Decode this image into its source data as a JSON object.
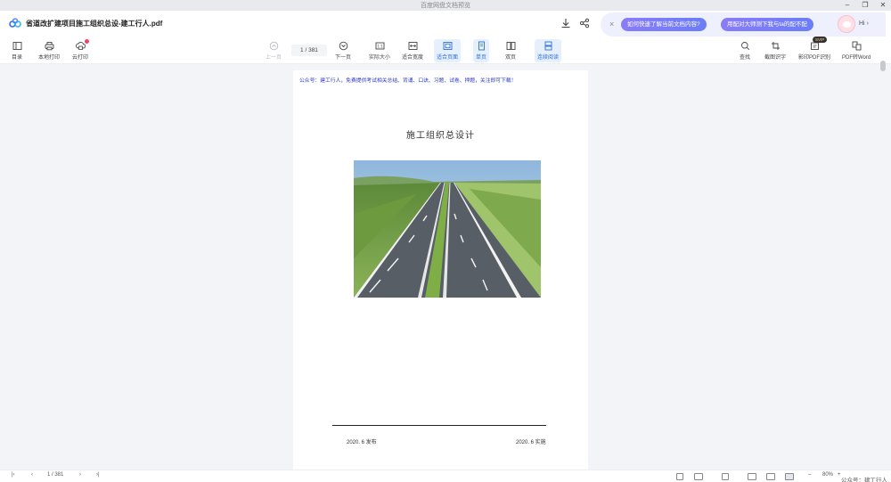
{
  "window": {
    "title": "百度网盘文档预览",
    "controls": [
      "minimize-icon",
      "restore-icon",
      "close-icon"
    ]
  },
  "header": {
    "doc_title": "省道改扩建项目施工组织总设-建工行人.pdf",
    "actions": [
      "download-icon",
      "share-icon"
    ]
  },
  "assistant": {
    "chips": [
      "如何快速了解当前文档内容?",
      "用配对大师测下我与ta的配不配"
    ],
    "greeting": "Hi",
    "chevron": "›",
    "close": "×"
  },
  "toolbar": {
    "left": [
      {
        "label": "目录",
        "icon": "catalog-icon"
      },
      {
        "label": "本地打印",
        "icon": "printer-icon"
      },
      {
        "label": "云打印",
        "icon": "cloud-print-icon"
      }
    ],
    "prev_label": "上一页",
    "page_indicator": "1 / 381",
    "next_label": "下一页",
    "view_modes": [
      {
        "label": "实际大小",
        "icon": "actual-size-icon",
        "active": false
      },
      {
        "label": "适合宽度",
        "icon": "fit-width-icon",
        "active": false
      },
      {
        "label": "适合页面",
        "icon": "fit-page-icon",
        "active": true
      },
      {
        "label": "单页",
        "icon": "single-page-icon",
        "active": true
      },
      {
        "label": "双页",
        "icon": "double-page-icon",
        "active": false
      },
      {
        "label": "连续阅读",
        "icon": "continuous-icon",
        "active": true
      }
    ],
    "right": [
      {
        "label": "查找",
        "icon": "search-icon"
      },
      {
        "label": "截图识字",
        "icon": "screenshot-ocr-icon"
      },
      {
        "label": "影印PDF识别",
        "icon": "pdf-ocr-icon"
      },
      {
        "label": "PDF转Word",
        "icon": "pdf-to-word-icon"
      }
    ],
    "svip_badge": "SVIP"
  },
  "document": {
    "notice": "公众号：建工行人，免费提供考试相关总结、背诵、口诀、习题、试卷、押题，关注即可下载！",
    "heading": "施工组织总设计",
    "image_alt": "highway-photo",
    "date_left": "2020. 6 发布",
    "date_right": "2020. 6 实施"
  },
  "statusbar": {
    "first": "|‹",
    "prev": "‹",
    "page": "1 / 381",
    "next": "›",
    "last": "›|",
    "zoom": "80%",
    "zoom_out": "–",
    "zoom_in": "+",
    "watermark": "公众号：建工行人"
  },
  "colors": {
    "accent": "#2d6fd8",
    "notice_text": "#2b35c9",
    "chip_gradient_start": "#8a7cf7",
    "chip_gradient_end": "#6b7df8",
    "badge": "#f5436d"
  }
}
